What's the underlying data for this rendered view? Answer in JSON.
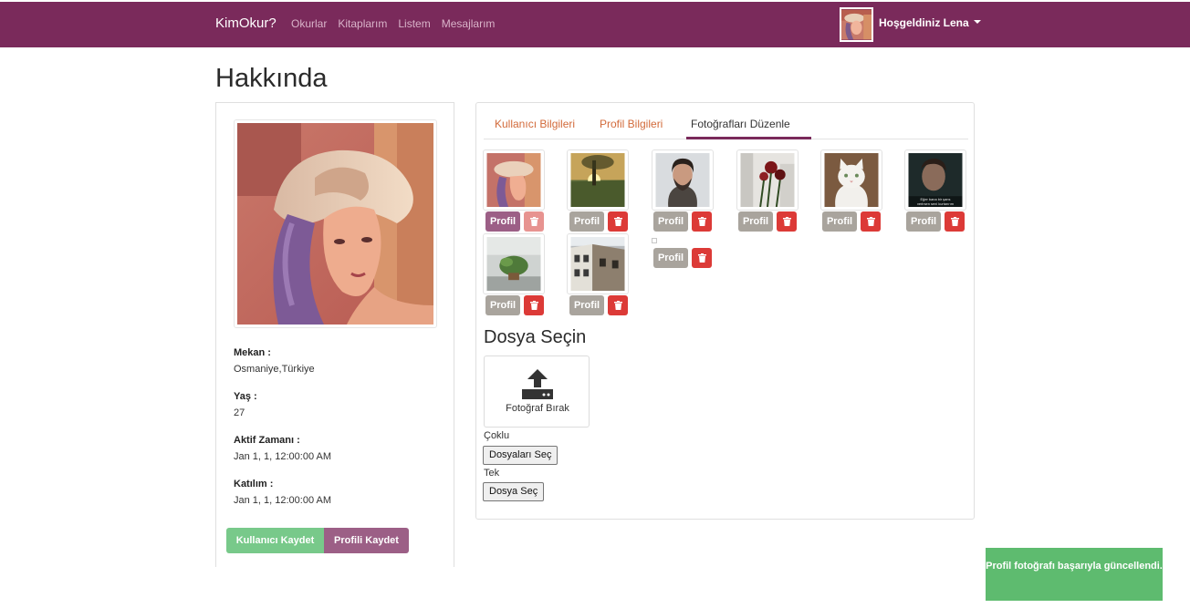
{
  "navbar": {
    "brand": "KimOkur?",
    "links": [
      "Okurlar",
      "Kitaplarım",
      "Listem",
      "Mesajlarım"
    ],
    "user_greeting": "Hoşgeldiniz Lena"
  },
  "page_title": "Hakkında",
  "profile": {
    "fields": [
      {
        "label": "Mekan :",
        "value": "Osmaniye,Türkiye"
      },
      {
        "label": "Yaş :",
        "value": "27"
      },
      {
        "label": "Aktif Zamanı :",
        "value": "Jan 1, 1, 12:00:00 AM"
      },
      {
        "label": "Katılım :",
        "value": "Jan 1, 1, 12:00:00 AM"
      }
    ],
    "save_user_label": "Kullanıcı Kaydet",
    "save_profile_label": "Profili Kaydet"
  },
  "tabs": [
    {
      "label": "Kullanıcı Bilgileri",
      "active": false
    },
    {
      "label": "Profil Bilgileri",
      "active": false
    },
    {
      "label": "Fotoğrafları Düzenle",
      "active": true
    }
  ],
  "photos": {
    "profile_button_label": "Profil",
    "items": [
      {
        "subject": "woman-with-hat",
        "is_profile": true
      },
      {
        "subject": "sunset-tree",
        "is_profile": false
      },
      {
        "subject": "bearded-man",
        "is_profile": false
      },
      {
        "subject": "red-roses",
        "is_profile": false
      },
      {
        "subject": "white-cat",
        "is_profile": false
      },
      {
        "subject": "movie-still",
        "is_profile": false,
        "caption": "Eğer bana bir şans verirsen seni kurtarırım"
      },
      {
        "subject": "potted-plant",
        "is_profile": false
      },
      {
        "subject": "old-houses",
        "is_profile": false
      },
      {
        "subject": "broken-image",
        "is_profile": false
      }
    ]
  },
  "upload": {
    "title": "Dosya Seçin",
    "dropzone_label": "Fotoğraf Bırak",
    "multi_label": "Çoklu",
    "multi_button": "Dosyaları Seç",
    "single_label": "Tek",
    "single_button": "Dosya Seç"
  },
  "toast": {
    "message": "Profil fotoğrafı başarıyla güncellendi."
  },
  "colors": {
    "navbar": "#7a2a5b",
    "profile_button_active": "#9c5f86",
    "profile_button": "#a9a49d",
    "delete_button": "#dc3a37",
    "success": "#5ebb6f",
    "tab_link": "#d26a3a"
  }
}
